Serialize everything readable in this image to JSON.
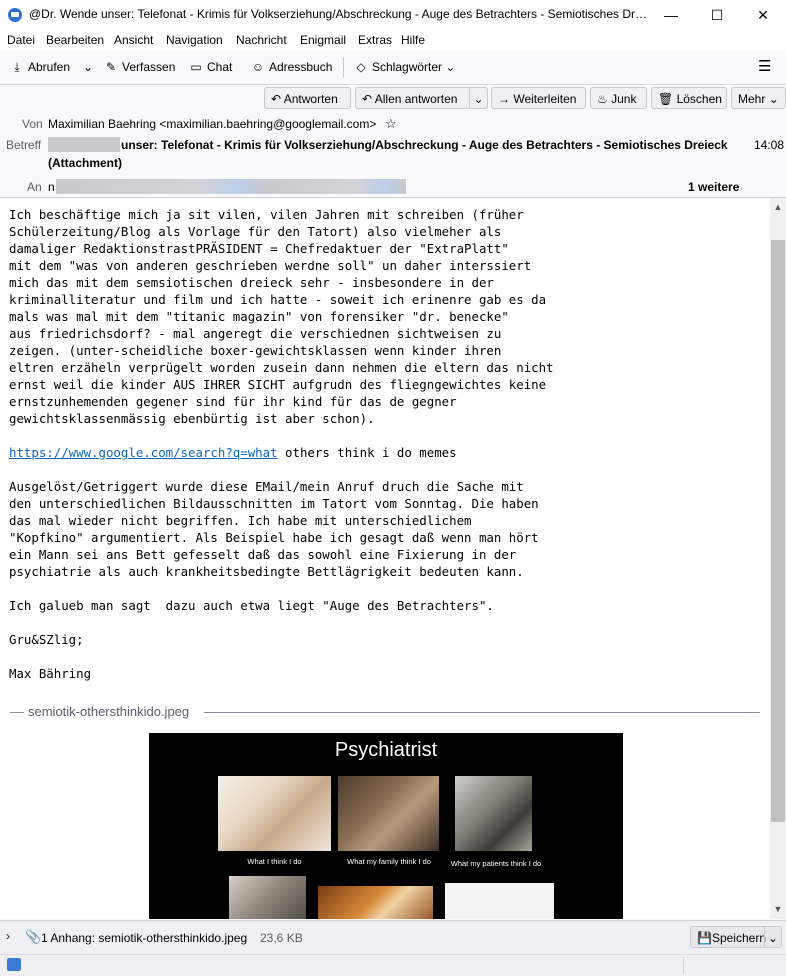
{
  "window": {
    "title": "@Dr. Wende unser: Telefonat - Krimis für Volkserziehung/Abschreckung - Auge des Betrachters - Semiotisches Dreie…",
    "minimize": "—",
    "maximize": "☐",
    "close": "✕"
  },
  "menu": [
    "Datei",
    "Bearbeiten",
    "Ansicht",
    "Navigation",
    "Nachricht",
    "Enigmail",
    "Extras",
    "Hilfe"
  ],
  "toolbar": {
    "get_mail": "Abrufen",
    "write": "Verfassen",
    "chat": "Chat",
    "address_book": "Adressbuch",
    "tags": "Schlagwörter",
    "hamburger": "☰"
  },
  "actions": {
    "reply": "Antworten",
    "reply_all": "Allen antworten",
    "forward": "Weiterleiten",
    "junk": "Junk",
    "delete": "Löschen",
    "more": "Mehr"
  },
  "header": {
    "from_label": "Von",
    "from_value": "Maximilian Baehring <maximilian.baehring@googlemail.com>",
    "subject_label": "Betreff",
    "subject_line1": "unser: Telefonat - Krimis für Volkserziehung/Abschreckung - Auge des Betrachters - Semiotisches Dreieck",
    "subject_line2": "(Attachment)",
    "time": "14:08",
    "to_label": "An",
    "to_value": "n",
    "more_recipients": "1 weitere"
  },
  "body": {
    "paragraph1": "Ich beschäftige mich ja sit vilen, vilen Jahren mit schreiben (früher\nSchülerzeitung/Blog als Vorlage für den Tatort) also vielmeher als\ndamaliger RedaktionstrastPRÄSIDENT = Chefredaktuer der \"ExtraPlatt\"\nmit dem \"was von anderen geschrieben werdne soll\" un daher interssiert\nmich das mit dem semsiotischen dreieck sehr - insbesondere in der\nkriminalliteratur und film und ich hatte - soweit ich erinenre gab es da\nmals was mal mit dem \"titanic magazin\" von forensiker \"dr. benecke\"\naus friedrichsdorf? - mal angeregt die verschiednen sichtweisen zu\nzeigen. (unter-scheidliche boxer-gewichtsklassen wenn kinder ihren\neltren erzäheln verprügelt worden zusein dann nehmen die eltern das nicht\nernst weil die kinder AUS IHRER SICHT aufgrudn des fliegngewichtes keine\nernstzunhemenden gegener sind für ihr kind für das de gegner\ngewichtsklassenmässig ebenbürtig ist aber schon).",
    "link": "https://www.google.com/search?q=what",
    "link_suffix": " others think i do memes",
    "paragraph2": "Ausgelöst/Getriggert wurde diese EMail/mein Anruf druch die Sache mit\nden unterschiedlichen Bildausschnitten im Tatort vom Sonntag. Die haben\ndas mal wieder nicht begriffen. Ich habe mit unterschiedlichem\n\"Kopfkino\" argumentiert. Als Beispiel habe ich gesagt daß wenn man hört\nein Mann sei ans Bett gefesselt daß das sowohl eine Fixierung in der\npsychiatrie als auch krankheitsbedingte Bettlägrigkeit bedeuten kann.",
    "paragraph3": "Ich galueb man sagt  dazu auch etwa liegt \"Auge des Betrachters\".",
    "greeting": "Gru&SZlig;",
    "signature": "Max Bähring"
  },
  "attachment": {
    "filename": "semiotik-othersthinkido.jpeg",
    "image_title": "Psychiatrist",
    "captions": [
      "What I think I do",
      "What my family think I do",
      "What my patients think I do"
    ],
    "bar_label": "1 Anhang: semiotik-othersthinkido.jpeg",
    "size": "23,6 KB",
    "save": "Speichern"
  }
}
